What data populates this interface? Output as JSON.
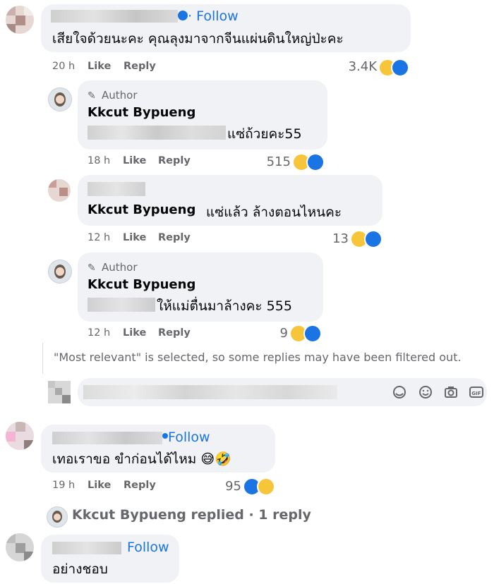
{
  "c1": {
    "follow": "· Follow",
    "text": "เสียใจด้วยนะคะ คุณลุงมาจากจีนแผ่นดินใหญ่ป่ะคะ",
    "time": "20 h",
    "like": "Like",
    "reply": "Reply",
    "count": "3.4K"
  },
  "r1": {
    "author_tag": "Author",
    "name": "Kkcut Bypueng",
    "text": "แซ่ถ้วยคะ55",
    "time": "18 h",
    "like": "Like",
    "reply": "Reply",
    "count": "515"
  },
  "r2": {
    "name": "Kkcut Bypueng",
    "text": "แซ่แล้ว ล้างตอนไหนคะ",
    "time": "12 h",
    "like": "Like",
    "reply": "Reply",
    "count": "13"
  },
  "r3": {
    "author_tag": "Author",
    "name": "Kkcut Bypueng",
    "text": "ให้แม่ตื่นมาล้างคะ 555",
    "time": "12 h",
    "like": "Like",
    "reply": "Reply",
    "count": "9"
  },
  "notice": "\"Most relevant\" is selected, so some replies may have been filtered out.",
  "c2": {
    "follow": "Follow",
    "text": "เทอเราขอ ขำก่อนได้ไหม 😅🤣",
    "time": "19 h",
    "like": "Like",
    "reply": "Reply",
    "count": "95"
  },
  "replied": {
    "text": "Kkcut Bypueng replied · 1 reply"
  },
  "c3": {
    "follow": "Follow",
    "text": "อย่างชอบ"
  },
  "colors": {
    "link": "#1b74e4",
    "bubble": "#f0f2f5",
    "meta": "#65676b"
  }
}
